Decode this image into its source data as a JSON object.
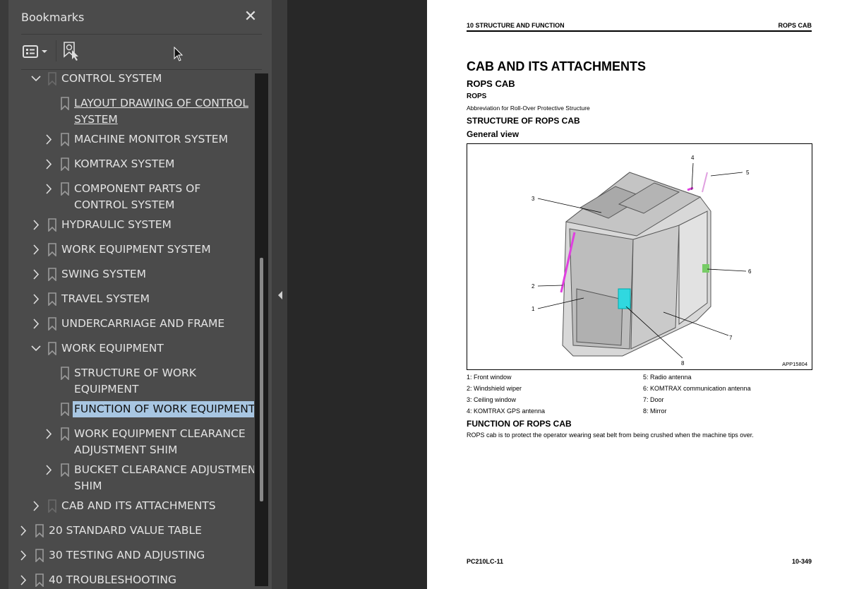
{
  "panel": {
    "title": "Bookmarks",
    "close_icon": "close-icon",
    "options_icon": "list-options-icon",
    "find_icon": "find-current-bookmark-icon"
  },
  "bookmarks": [
    {
      "label": "CONTROL SYSTEM",
      "level": 1,
      "expandable": true,
      "expanded": true,
      "lines": [
        "CONTROL SYSTEM"
      ],
      "dim": true
    },
    {
      "label": "LAYOUT DRAWING OF CONTROL SYSTEM",
      "level": 2,
      "expandable": false,
      "lines": [
        "LAYOUT DRAWING OF CONTROL ",
        "SYSTEM"
      ],
      "underlined": true
    },
    {
      "label": "MACHINE MONITOR SYSTEM",
      "level": 2,
      "expandable": true,
      "lines": [
        "MACHINE MONITOR SYSTEM"
      ]
    },
    {
      "label": "KOMTRAX SYSTEM",
      "level": 2,
      "expandable": true,
      "lines": [
        "KOMTRAX SYSTEM"
      ]
    },
    {
      "label": "COMPONENT PARTS OF CONTROL SYSTEM",
      "level": 2,
      "expandable": true,
      "lines": [
        "COMPONENT PARTS OF",
        "CONTROL SYSTEM"
      ]
    },
    {
      "label": "HYDRAULIC SYSTEM",
      "level": 1,
      "expandable": true,
      "lines": [
        "HYDRAULIC SYSTEM"
      ]
    },
    {
      "label": "WORK EQUIPMENT SYSTEM",
      "level": 1,
      "expandable": true,
      "lines": [
        "WORK EQUIPMENT SYSTEM"
      ]
    },
    {
      "label": "SWING SYSTEM",
      "level": 1,
      "expandable": true,
      "lines": [
        "SWING SYSTEM"
      ]
    },
    {
      "label": "TRAVEL SYSTEM",
      "level": 1,
      "expandable": true,
      "lines": [
        "TRAVEL SYSTEM"
      ]
    },
    {
      "label": "UNDERCARRIAGE AND FRAME",
      "level": 1,
      "expandable": true,
      "lines": [
        "UNDERCARRIAGE AND FRAME"
      ]
    },
    {
      "label": "WORK EQUIPMENT",
      "level": 1,
      "expandable": true,
      "expanded": true,
      "lines": [
        "WORK EQUIPMENT"
      ]
    },
    {
      "label": "STRUCTURE OF WORK EQUIPMENT",
      "level": 2,
      "expandable": false,
      "lines": [
        "STRUCTURE OF WORK",
        "EQUIPMENT"
      ]
    },
    {
      "label": "FUNCTION OF WORK EQUIPMENT",
      "level": 2,
      "expandable": false,
      "lines": [
        "FUNCTION OF WORK EQUIPMENT"
      ],
      "selected": true
    },
    {
      "label": "WORK EQUIPMENT CLEARANCE ADJUSTMENT SHIM",
      "level": 2,
      "expandable": true,
      "lines": [
        "WORK EQUIPMENT CLEARANCE",
        "ADJUSTMENT SHIM"
      ]
    },
    {
      "label": "BUCKET CLEARANCE ADJUSTMENT SHIM",
      "level": 2,
      "expandable": true,
      "lines": [
        "BUCKET CLEARANCE ADJUSTMENT",
        "SHIM"
      ]
    },
    {
      "label": "CAB AND ITS ATTACHMENTS",
      "level": 1,
      "expandable": true,
      "lines": [
        "CAB AND ITS ATTACHMENTS"
      ],
      "dim": true
    },
    {
      "label": "20 STANDARD VALUE TABLE",
      "level": 0,
      "expandable": true,
      "lines": [
        "20 STANDARD VALUE TABLE"
      ]
    },
    {
      "label": "30 TESTING AND ADJUSTING",
      "level": 0,
      "expandable": true,
      "lines": [
        "30 TESTING AND ADJUSTING"
      ]
    },
    {
      "label": "40 TROUBLESHOOTING",
      "level": 0,
      "expandable": true,
      "lines": [
        "40 TROUBLESHOOTING"
      ]
    }
  ],
  "page": {
    "header_left": "10 STRUCTURE AND FUNCTION",
    "header_right": "ROPS CAB",
    "title": "CAB AND ITS ATTACHMENTS",
    "subtitle": "ROPS CAB",
    "term": "ROPS",
    "term_definition": "Abbreviation for Roll-Over Protective Structure",
    "section_structure": "STRUCTURE OF ROPS CAB",
    "subsection": "General view",
    "figure_code": "APP15804",
    "callouts": [
      "1",
      "2",
      "3",
      "4",
      "5",
      "6",
      "7",
      "8"
    ],
    "legend": [
      "1: Front window",
      "2: Windshield wiper",
      "3: Ceiling window",
      "4: KOMTRAX GPS antenna",
      "5: Radio antenna",
      "6: KOMTRAX communication antenna",
      "7: Door",
      "8: Mirror"
    ],
    "section_function": "FUNCTION OF ROPS CAB",
    "function_text": "ROPS cab is to protect the operator wearing seat belt from being crushed when the machine tips over.",
    "footer_left": "PC210LC-11",
    "footer_right": "10-349"
  },
  "colors": {
    "selection": "#a8c6e2",
    "panel": "#4b4b4b",
    "accent_magenta": "#e040e0",
    "accent_cyan": "#30d8e0"
  }
}
